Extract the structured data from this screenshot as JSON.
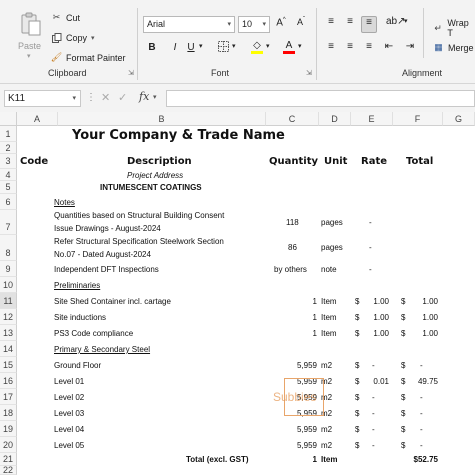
{
  "clipboard": {
    "paste_label": "Paste",
    "cut_label": "Cut",
    "copy_label": "Copy",
    "format_painter_label": "Format Painter",
    "group_label": "Clipboard"
  },
  "font": {
    "name": "Arial",
    "size": "10",
    "group_label": "Font",
    "fill_color": "#ffff00",
    "font_color": "#ff0000"
  },
  "alignment": {
    "wrap_text_label": "Wrap T",
    "merge_label": "Merge",
    "group_label": "Alignment"
  },
  "formula_bar": {
    "name_box": "K11",
    "formula": ""
  },
  "columns": [
    "A",
    "B",
    "C",
    "D",
    "E",
    "F",
    "G"
  ],
  "rows": [
    "1",
    "2",
    "3",
    "4",
    "5",
    "6",
    "7",
    "8",
    "9",
    "10",
    "11",
    "12",
    "13",
    "14",
    "15",
    "16",
    "17",
    "18",
    "19",
    "20",
    "21",
    "22"
  ],
  "sheet": {
    "r1": {
      "title": "Your Company & Trade Name"
    },
    "r3": {
      "code": "Code",
      "description": "Description",
      "quantity": "Quantity",
      "unit": "Unit",
      "rate": "Rate",
      "total": "Total"
    },
    "r4": {
      "b": "Project Address"
    },
    "r5": {
      "b": "INTUMESCENT COATINGS"
    },
    "r6": {
      "b": "Notes"
    },
    "r7": {
      "b1": "Quantities based on Structural Building Consent",
      "b2": "Issue Drawings - August-2024",
      "qty": "118",
      "unit": "pages",
      "rate": "-"
    },
    "r8": {
      "b1": "Refer Structural Specification Steelwork Section",
      "b2": "No.07 - Dated August-2024",
      "qty": "86",
      "unit": "pages",
      "rate": "-"
    },
    "r9": {
      "b": "Independent DFT Inspections",
      "qty": "by others",
      "unit": "note",
      "rate": "-"
    },
    "r10": {
      "b": "Preliminaries"
    },
    "r11": {
      "b": "Site Shed Container incl. cartage",
      "qty": "1",
      "unit": "Item",
      "rate_sym": "$",
      "rate": "1.00",
      "total_sym": "$",
      "total": "1.00"
    },
    "r12": {
      "b": "Site inductions",
      "qty": "1",
      "unit": "Item",
      "rate_sym": "$",
      "rate": "1.00",
      "total_sym": "$",
      "total": "1.00"
    },
    "r13": {
      "b": "PS3 Code compliance",
      "qty": "1",
      "unit": "Item",
      "rate_sym": "$",
      "rate": "1.00",
      "total_sym": "$",
      "total": "1.00"
    },
    "r14": {
      "b": "Primary & Secondary Steel"
    },
    "r15": {
      "b": "Ground Floor",
      "qty": "5,959",
      "unit": "m2",
      "rate_sym": "$",
      "rate": "-",
      "total_sym": "$",
      "total": "-"
    },
    "r16": {
      "b": "Level 01",
      "qty": "5,959",
      "unit": "m2",
      "rate_sym": "$",
      "rate": "0.01",
      "total_sym": "$",
      "total": "49.75"
    },
    "r17": {
      "b": "Level 02",
      "qty": "5,959",
      "unit": "m2",
      "rate_sym": "$",
      "rate": "-",
      "total_sym": "$",
      "total": "-"
    },
    "r18": {
      "b": "Level 03",
      "qty": "5,959",
      "unit": "m2",
      "rate_sym": "$",
      "rate": "-",
      "total_sym": "$",
      "total": "-"
    },
    "r19": {
      "b": "Level 04",
      "qty": "5,959",
      "unit": "m2",
      "rate_sym": "$",
      "rate": "-",
      "total_sym": "$",
      "total": "-"
    },
    "r20": {
      "b": "Level 05",
      "qty": "5,959",
      "unit": "m2",
      "rate_sym": "$",
      "rate": "-",
      "total_sym": "$",
      "total": "-"
    },
    "r21": {
      "b": "Total (excl. GST)",
      "qty": "1",
      "unit": "Item",
      "total": "$52.75"
    }
  },
  "watermark": "Subbies"
}
